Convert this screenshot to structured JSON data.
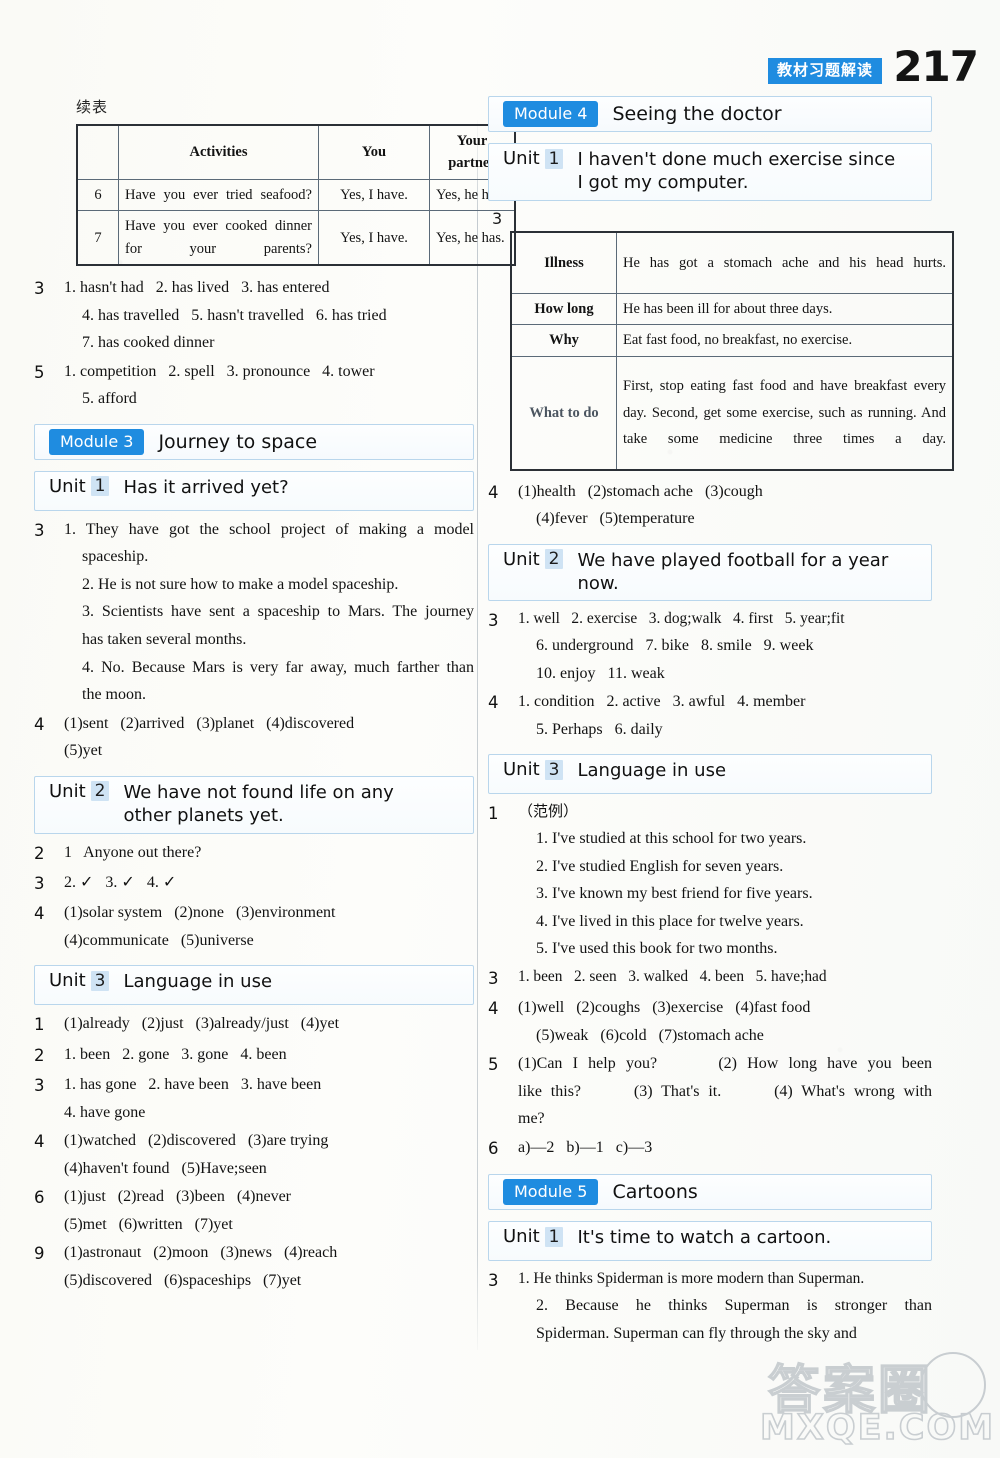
{
  "header": {
    "badge_cn": "教材习题解读",
    "page_number": "217",
    "accent_blue": "#1f8ce0"
  },
  "left_column": {
    "continued_label": "续表",
    "table": {
      "headers": [
        "",
        "Activities",
        "You",
        "Your partner"
      ],
      "rows": [
        {
          "no": "6",
          "activity": "Have you ever tried seafood?",
          "you": "Yes, I have.",
          "partner": "Yes, he has."
        },
        {
          "no": "7",
          "activity": "Have you ever cooked dinner for your parents?",
          "you": "Yes, I have.",
          "partner": "Yes, he has."
        }
      ]
    },
    "answers_top": [
      {
        "no": "3",
        "lines": [
          "1. hasn't had   2. has lived   3. has entered",
          "4. has travelled   5. hasn't travelled   6. has tried",
          "7. has cooked dinner"
        ]
      },
      {
        "no": "5",
        "lines": [
          "1. competition   2. spell   3. pronounce   4. tower",
          "5. afford"
        ]
      }
    ],
    "module": {
      "badge": "Module 3",
      "title": "Journey to space"
    },
    "unit1": {
      "label": "Unit",
      "num": "1",
      "title": "Has it arrived yet?"
    },
    "unit1_answers": [
      {
        "no": "3",
        "lines": [
          "1. They have got the school project of making a model",
          "spaceship.",
          "2. He is not sure how to make a model spaceship.",
          "3. Scientists have sent a spaceship to Mars. The journey",
          "has taken several months.",
          "4. No. Because Mars is very far away, much farther than",
          "the moon."
        ]
      },
      {
        "no": "4",
        "lines": [
          "(1)sent   (2)arrived   (3)planet   (4)discovered",
          "(5)yet"
        ]
      }
    ],
    "unit2": {
      "label": "Unit",
      "num": "2",
      "title": "We have not found life on any other planets yet."
    },
    "unit2_answers": [
      {
        "no": "2",
        "lines": [
          "1   Anyone out there?"
        ]
      },
      {
        "no": "3",
        "lines": [
          "2. ✓   3. ✓   4. ✓"
        ]
      },
      {
        "no": "4",
        "lines": [
          "(1)solar system   (2)none   (3)environment",
          "(4)communicate   (5)universe"
        ]
      }
    ],
    "unit3": {
      "label": "Unit",
      "num": "3",
      "title": "Language in use"
    },
    "unit3_answers": [
      {
        "no": "1",
        "lines": [
          "(1)already   (2)just   (3)already/just   (4)yet"
        ]
      },
      {
        "no": "2",
        "lines": [
          "1. been   2. gone   3. gone   4. been"
        ]
      },
      {
        "no": "3",
        "lines": [
          "1. has gone   2. have been   3. have been",
          "4. have gone"
        ]
      },
      {
        "no": "4",
        "lines": [
          "(1)watched   (2)discovered   (3)are trying",
          "(4)haven't found   (5)Have;seen"
        ]
      },
      {
        "no": "6",
        "lines": [
          "(1)just   (2)read   (3)been   (4)never",
          "(5)met   (6)written   (7)yet"
        ]
      },
      {
        "no": "9",
        "lines": [
          "(1)astronaut   (2)moon   (3)news   (4)reach",
          "(5)discovered   (6)spaceships   (7)yet"
        ]
      }
    ]
  },
  "right_column": {
    "module4": {
      "badge": "Module 4",
      "title": "Seeing the doctor"
    },
    "unit1": {
      "label": "Unit",
      "num": "1",
      "title": "I haven't done much exercise since I got my computer."
    },
    "exercise_lead": "3",
    "illness_table": {
      "rows": [
        {
          "label": "Illness",
          "value": "He has got a stomach ache and his head hurts."
        },
        {
          "label": "How long",
          "value": "He has been ill for about three days."
        },
        {
          "label": "Why",
          "value": "Eat fast food, no breakfast, no exercise."
        },
        {
          "label": "What to do",
          "value": "First, stop eating fast food and have breakfast every day. Second, get some exercise, such as running. And take some medicine three times a day."
        }
      ]
    },
    "unit1_answers": [
      {
        "no": "4",
        "lines": [
          "(1)health   (2)stomach ache   (3)cough",
          "(4)fever   (5)temperature"
        ]
      }
    ],
    "unit2": {
      "label": "Unit",
      "num": "2",
      "title": "We have played football for a year now."
    },
    "unit2_answers": [
      {
        "no": "3",
        "lines": [
          "1. well   2. exercise   3. dog;walk   4. first   5. year;fit",
          "6. underground   7. bike   8. smile   9. week",
          "10. enjoy   11. weak"
        ]
      },
      {
        "no": "4",
        "lines": [
          "1. condition   2. active   3. awful   4. member",
          "5. Perhaps   6. daily"
        ]
      }
    ],
    "unit3": {
      "label": "Unit",
      "num": "3",
      "title": "Language in use"
    },
    "unit3_answers": [
      {
        "no": "1",
        "lines": [
          "（范例）",
          "1. I've studied at this school for two years.",
          "2. I've studied English for seven years.",
          "3. I've known my best friend for five years.",
          "4. I've lived in this place for twelve years.",
          "5. I've used this book for two months."
        ]
      },
      {
        "no": "3",
        "lines": [
          "1. been   2. seen   3. walked   4. been   5. have;had"
        ]
      },
      {
        "no": "4",
        "lines": [
          "(1)well   (2)coughs   (3)exercise   (4)fast food",
          "(5)weak   (6)cold   (7)stomach ache"
        ]
      },
      {
        "no": "5",
        "lines": [
          "(1)Can I help you?      (2) How long have you been",
          "like this?      (3) That's it.      (4) What's wrong with",
          "me?"
        ]
      },
      {
        "no": "6",
        "lines": [
          "a)—2   b)—1   c)—3"
        ]
      }
    ],
    "module5": {
      "badge": "Module 5",
      "title": "Cartoons"
    },
    "m5_unit1": {
      "label": "Unit",
      "num": "1",
      "title": "It's time to watch a cartoon."
    },
    "m5_answers": [
      {
        "no": "3",
        "lines": [
          "1. He thinks Spiderman is more modern than Superman.",
          "2. Because he thinks Superman is stronger than",
          "Spiderman. Superman can fly through the sky and"
        ]
      }
    ]
  },
  "watermark": {
    "cn": "答案圈",
    "site": "MXQE.COM"
  }
}
